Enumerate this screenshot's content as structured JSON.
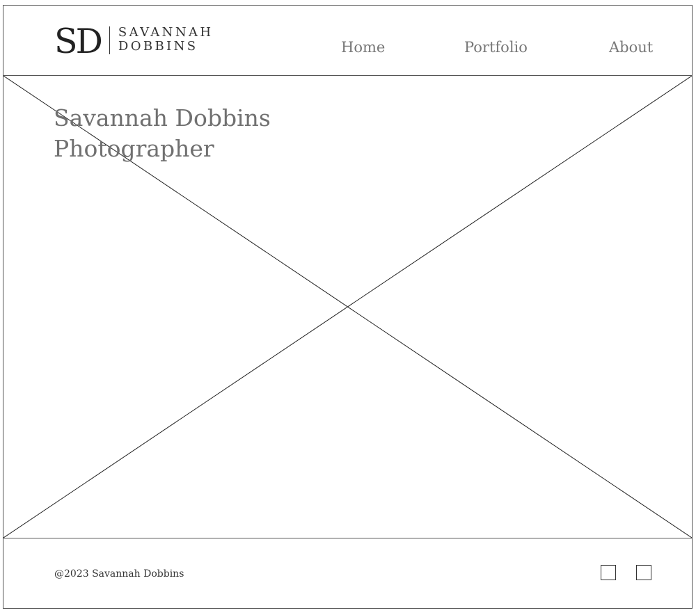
{
  "header": {
    "logo": {
      "monogram": "SD",
      "name_line1": "SAVANNAH",
      "name_line2": "DOBBINS"
    },
    "nav": [
      {
        "label": "Home"
      },
      {
        "label": "Portfolio"
      },
      {
        "label": "About"
      }
    ]
  },
  "hero": {
    "title_line1": "Savannah Dobbins",
    "title_line2": "Photographer",
    "image": "image-placeholder"
  },
  "footer": {
    "copyright": "@2023 Savannah Dobbins",
    "social_icons": [
      "social-icon",
      "social-icon"
    ]
  },
  "colors": {
    "border": "#555555",
    "nav_text": "#777777",
    "title_text": "#707070",
    "dark_text": "#222222"
  }
}
